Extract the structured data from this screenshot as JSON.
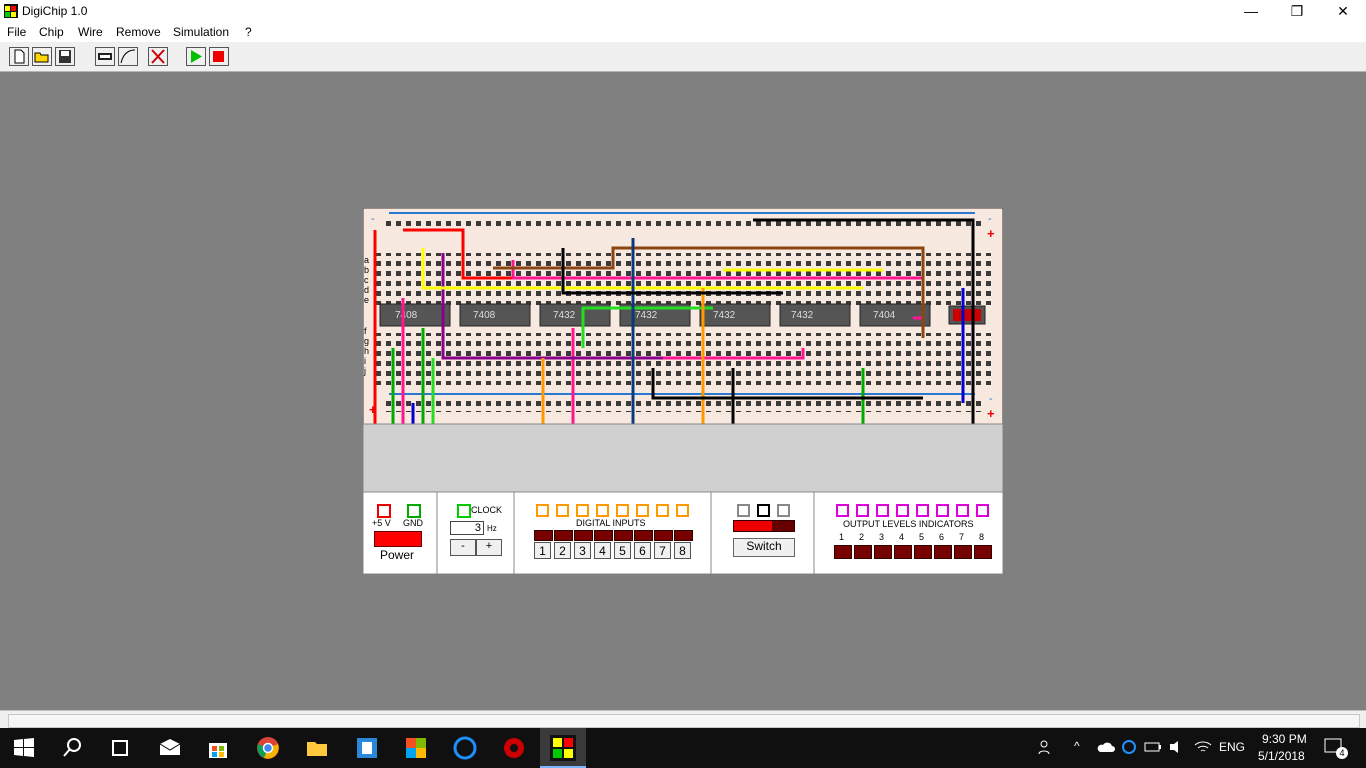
{
  "window": {
    "title": "DigiChip 1.0",
    "minimize_glyph": "—",
    "maximize_glyph": "❐",
    "close_glyph": "✕"
  },
  "menu": [
    "File",
    "Chip",
    "Wire",
    "Remove",
    "Simulation",
    "?"
  ],
  "toolbar": {
    "icons": [
      "new-file-icon",
      "open-folder-icon",
      "save-disk-icon",
      "add-chip-icon",
      "add-wire-icon",
      "remove-icon",
      "run-icon",
      "stop-icon"
    ]
  },
  "board": {
    "rail_minus": "-",
    "rail_plus": "+",
    "row_letters_top": [
      "a",
      "b",
      "c",
      "d",
      "e"
    ],
    "row_letters_bottom": [
      "f",
      "g",
      "h",
      "i",
      "j"
    ],
    "chips": [
      "7408",
      "7408",
      "7432",
      "7432",
      "7432",
      "7432",
      "7404"
    ]
  },
  "panel": {
    "power": {
      "plus_label": "+5 V",
      "gnd_label": "GND",
      "button_label": "Power"
    },
    "clock": {
      "label": "CLOCK",
      "value": "3",
      "unit": "Hz",
      "minus": "-",
      "plus": "+"
    },
    "digital_inputs": {
      "label": "DIGITAL INPUTS",
      "buttons": [
        "1",
        "2",
        "3",
        "4",
        "5",
        "6",
        "7",
        "8"
      ]
    },
    "switch": {
      "label": "Switch"
    },
    "output_indicators": {
      "label": "OUTPUT LEVELS INDICATORS",
      "numbers": [
        "1",
        "2",
        "3",
        "4",
        "5",
        "6",
        "7",
        "8"
      ]
    }
  },
  "taskbar": {
    "apps": [
      "start-icon",
      "search-icon",
      "task-view-icon",
      "mail-icon",
      "store-icon",
      "chrome-icon",
      "file-explorer-icon",
      "app-icon-1",
      "office-icon",
      "cc-icon",
      "app-icon-2",
      "digichip-icon"
    ],
    "language": "ENG",
    "time": "9:30 PM",
    "date": "5/1/2018",
    "notifications": "4"
  },
  "colors": {
    "red": "#ff0000",
    "green": "#00aa00",
    "blue": "#0000cc",
    "pink": "#ff1493",
    "yellow": "#ffff00",
    "orange": "#ff9900",
    "purple": "#8b008b",
    "brown": "#8b4513",
    "black": "#000000",
    "navy": "#0a3a7a"
  }
}
